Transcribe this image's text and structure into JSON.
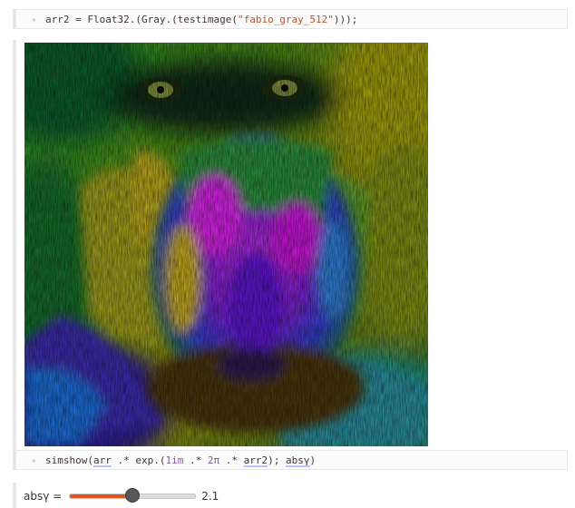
{
  "cells": {
    "load": {
      "code": [
        {
          "t": "arr2",
          "c": "tok-fn"
        },
        {
          "t": " = ",
          "c": "tok-op"
        },
        {
          "t": "Float32.(Gray.(testimage(",
          "c": "tok-fn"
        },
        {
          "t": "\"fabio_gray_512\"",
          "c": "tok-str"
        },
        {
          "t": ")));",
          "c": "tok-op"
        }
      ]
    },
    "show": {
      "code": [
        {
          "t": "simshow(",
          "c": "tok-fn"
        },
        {
          "t": "arr",
          "c": "tok-var"
        },
        {
          "t": " .* exp.(",
          "c": "tok-op"
        },
        {
          "t": "1im",
          "c": "tok-num"
        },
        {
          "t": " .* ",
          "c": "tok-op"
        },
        {
          "t": "2π",
          "c": "tok-num"
        },
        {
          "t": " .* ",
          "c": "tok-op"
        },
        {
          "t": "arr2",
          "c": "tok-var"
        },
        {
          "t": "); ",
          "c": "tok-op"
        },
        {
          "t": "absγ",
          "c": "tok-var"
        },
        {
          "t": ")",
          "c": "tok-op"
        }
      ]
    }
  },
  "output_image": {
    "description_icon": "complex-phase-image"
  },
  "slider": {
    "label": "absγ =",
    "value": "2.1",
    "fraction": 0.5,
    "accent": "#e1551f"
  },
  "colors": {
    "cell_border": "#e6e6e6",
    "string": "#c24f24",
    "number": "#815ba4"
  }
}
